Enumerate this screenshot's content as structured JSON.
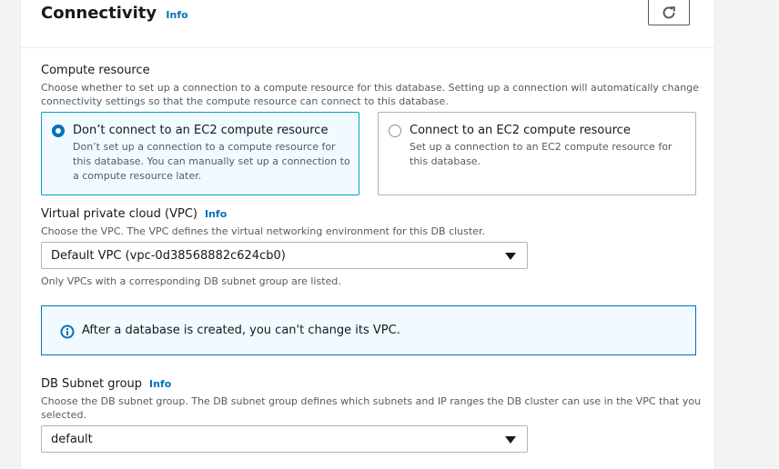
{
  "section": {
    "title": "Connectivity",
    "info": "Info",
    "refresh_icon": "refresh-icon"
  },
  "compute": {
    "label": "Compute resource",
    "description_line1": "Choose whether to set up a connection to a compute resource for this database. Setting up a connection will automatically change",
    "description_line2": "connectivity settings so that the compute resource can connect to this database.",
    "options": [
      {
        "title": "Don’t connect to an EC2 compute resource",
        "desc_line1": "Don’t set up a connection to a compute resource for",
        "desc_line2": "this database. You can manually set up a connection to",
        "desc_line3": "a compute resource later.",
        "selected": true
      },
      {
        "title": "Connect to an EC2 compute resource",
        "desc_line1": "Set up a connection to an EC2 compute resource for",
        "desc_line2": "this database.",
        "selected": false
      }
    ]
  },
  "vpc": {
    "label": "Virtual private cloud (VPC)",
    "info": "Info",
    "description": "Choose the VPC. The VPC defines the virtual networking environment for this DB cluster.",
    "selected": "Default VPC (vpc-0d38568882c624cb0)",
    "hint": "Only VPCs with a corresponding DB subnet group are listed."
  },
  "alert": {
    "text": "After a database is created, you can't change its VPC.",
    "icon": "info-circle-icon",
    "color": "#0073bb"
  },
  "subnet": {
    "label": "DB Subnet group",
    "info": "Info",
    "description_line1": "Choose the DB subnet group. The DB subnet group defines which subnets and IP ranges the DB cluster can use in the VPC that you",
    "description_line2": "selected.",
    "selected": "default"
  }
}
